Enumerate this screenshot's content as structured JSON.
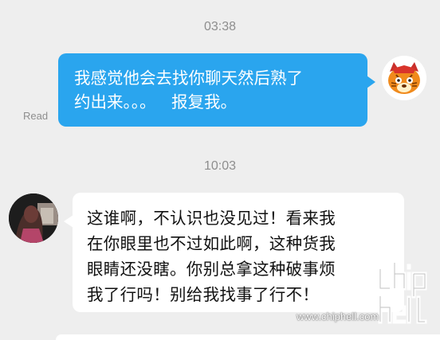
{
  "messages": {
    "time_1": "03:38",
    "outgoing": {
      "lines": [
        "我感觉他会去找你聊天然后熟了",
        "约出来。。。   报复我。"
      ],
      "status": "Read"
    },
    "time_2": "10:03",
    "incoming": {
      "lines": [
        "这谁啊，不认识也没见过！看来我",
        "在你眼里也不过如此啊，这种货我",
        "眼睛还没瞎。你别总拿这种破事烦",
        "我了行吗！别给我找事了行不！"
      ]
    }
  },
  "watermark": {
    "url": "www.chiphell.com",
    "logo_text": "chiphell"
  },
  "colors": {
    "background": "#eeeeee",
    "outgoing_bubble": "#2aa5ee",
    "incoming_bubble": "#ffffff",
    "timestamp": "#8e8e8e"
  },
  "icons": {
    "my_avatar": "cartoon-tiger-avatar",
    "contact_avatar": "photo-avatar"
  }
}
